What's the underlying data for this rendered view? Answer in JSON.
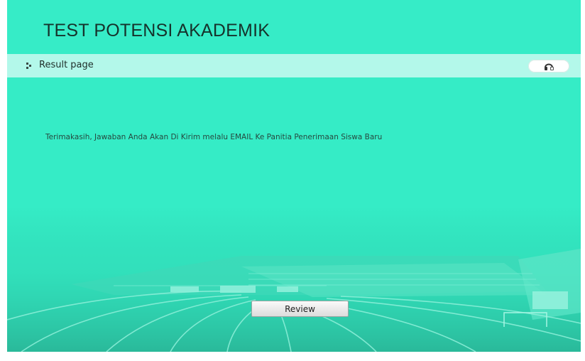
{
  "header": {
    "title": "TEST POTENSI AKADEMIK"
  },
  "topbar": {
    "label": "Result page",
    "label_icon": "expand-icon",
    "headset_icon": "headset-icon"
  },
  "main": {
    "message": "Terimakasih, Jawaban Anda Akan Di Kirim melalu EMAIL Ke Panitia Penerimaan Siswa Baru",
    "review_label": "Review"
  },
  "colors": {
    "background": "#35ecc6",
    "bar": "#b3f8ea",
    "title": "#16322b"
  }
}
